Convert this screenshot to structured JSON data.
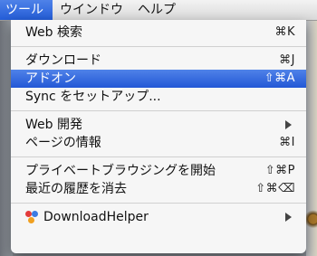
{
  "menubar": {
    "items": [
      "ツール",
      "ウインドウ",
      "ヘルプ"
    ]
  },
  "menu": {
    "web_search": {
      "label": "Web 検索",
      "shortcut": "⌘K"
    },
    "downloads": {
      "label": "ダウンロード",
      "shortcut": "⌘J"
    },
    "addons": {
      "label": "アドオン",
      "shortcut": "⇧⌘A"
    },
    "sync_setup": {
      "label": "Sync をセットアップ..."
    },
    "web_dev": {
      "label": "Web 開発"
    },
    "page_info": {
      "label": "ページの情報",
      "shortcut": "⌘I"
    },
    "private_browsing": {
      "label": "プライベートブラウジングを開始",
      "shortcut": "⇧⌘P"
    },
    "clear_history": {
      "label": "最近の履歴を消去",
      "shortcut": "⇧⌘⌫"
    },
    "download_helper": {
      "label": "DownloadHelper"
    }
  },
  "colors": {
    "highlight": "#2f6ae0",
    "menubar_active": "#3a70e0"
  },
  "icons": {
    "submenu": "submenu-arrow-icon",
    "download_helper": "downloadhelper-icon"
  }
}
